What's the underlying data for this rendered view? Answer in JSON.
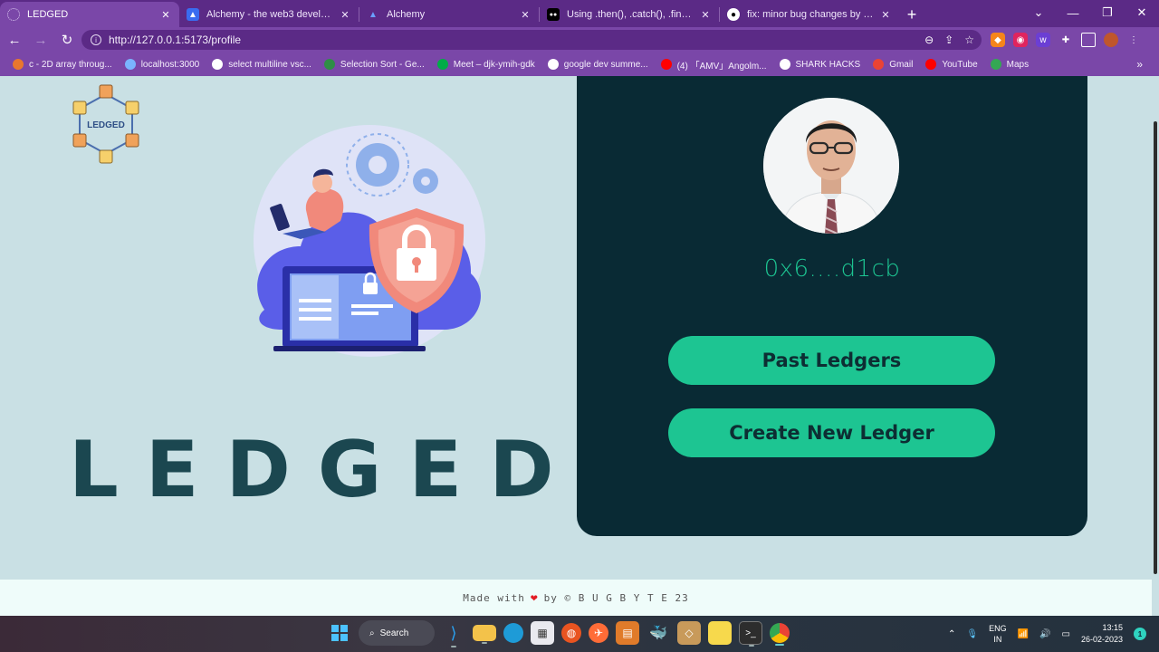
{
  "browser": {
    "tabs": [
      {
        "title": "LEDGED",
        "active": true,
        "icon": "loading-icon"
      },
      {
        "title": "Alchemy - the web3 developmen",
        "active": false,
        "icon": "alchemy-icon"
      },
      {
        "title": "Alchemy",
        "active": false,
        "icon": "alchemy-icon"
      },
      {
        "title": "Using .then(), .catch(), .finally() to",
        "active": false,
        "icon": "dev-icon"
      },
      {
        "title": "fix: minor bug changes by IRSHIT",
        "active": false,
        "icon": "github-icon"
      }
    ],
    "new_tab": "+",
    "url": "http://127.0.0.1:5173/profile",
    "bookmarks": [
      {
        "label": "c - 2D array throug...",
        "color": "#e8772e"
      },
      {
        "label": "localhost:3000",
        "color": "#7ab4ff"
      },
      {
        "label": "select multiline vsc...",
        "color": "#ffffff"
      },
      {
        "label": "Selection Sort - Ge...",
        "color": "#2f8d46"
      },
      {
        "label": "Meet – djk-ymih-gdk",
        "color": "#00ac47"
      },
      {
        "label": "google dev summe...",
        "color": "#ffffff"
      },
      {
        "label": "(4) 「AMV」Angolm...",
        "color": "#ff0000"
      },
      {
        "label": "SHARK HACKS",
        "color": "#ffffff"
      },
      {
        "label": "Gmail",
        "color": "#ea4335"
      },
      {
        "label": "YouTube",
        "color": "#ff0000"
      },
      {
        "label": "Maps",
        "color": "#34a853"
      }
    ],
    "more_bookmarks": "»"
  },
  "page": {
    "logo_text": "LEDGED",
    "brand_word": "LEDGED",
    "profile": {
      "address": "0x6....d1cb",
      "past_ledgers_label": "Past Ledgers",
      "create_ledger_label": "Create New Ledger"
    },
    "footer": {
      "made_with": "Made with",
      "by": "by © B U G B Y T E 23"
    },
    "colors": {
      "background": "#c9e0e4",
      "card": "#092a34",
      "accent": "#1dc592",
      "brand_text": "#1b4750"
    }
  },
  "taskbar": {
    "search_label": "Search",
    "language": "ENG",
    "region": "IN",
    "time": "13:15",
    "date": "26-02-2023",
    "notification_count": "1"
  }
}
